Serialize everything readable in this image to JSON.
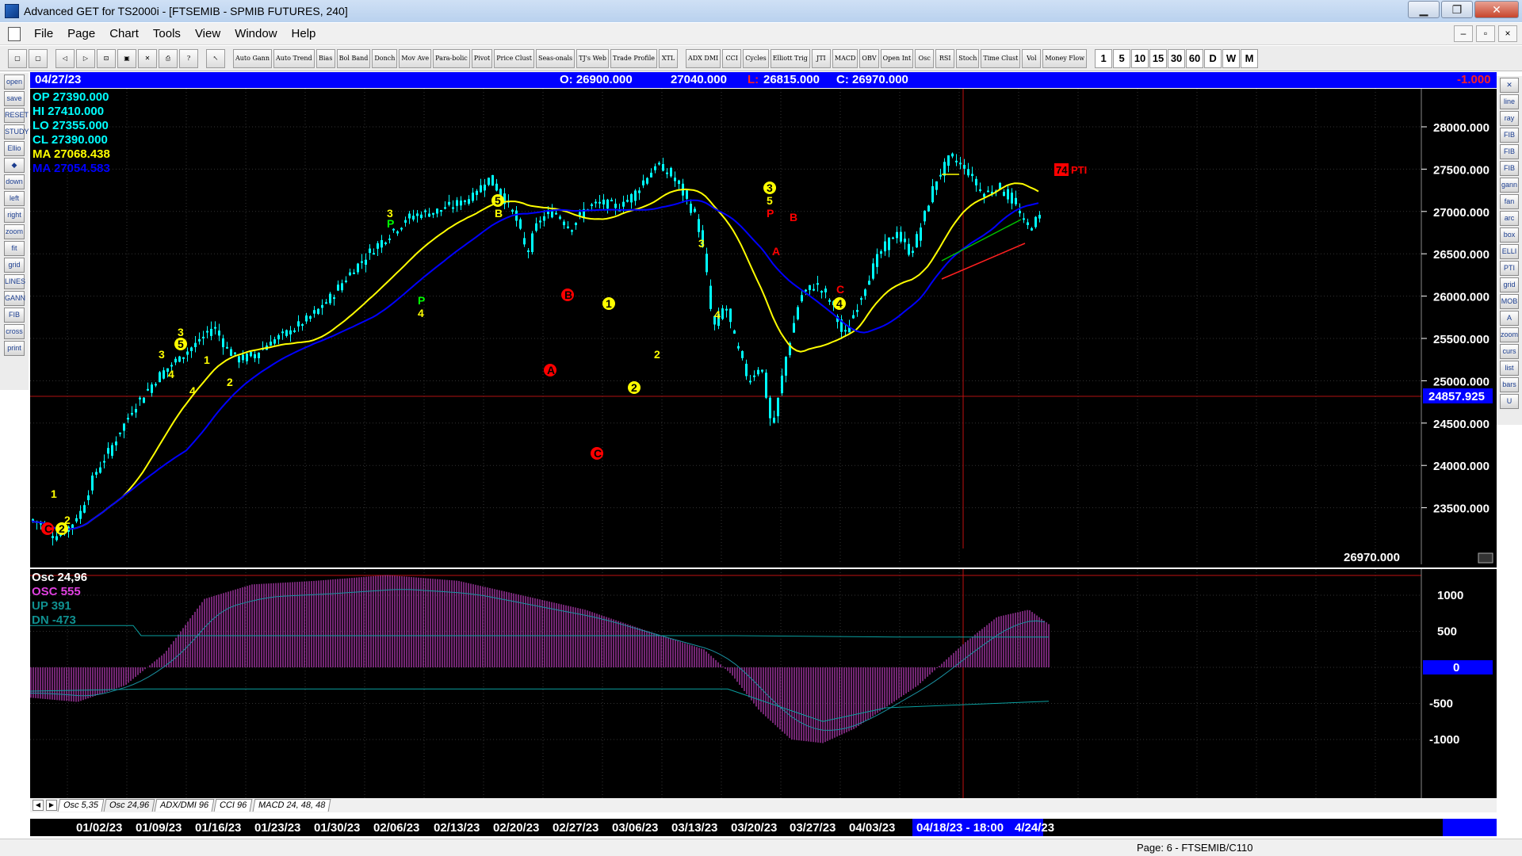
{
  "window": {
    "title": "Advanced GET for TS2000i - [FTSEMIB - SPMIB FUTURES, 240]",
    "minimize": "▁",
    "maximize": "❐",
    "close": "✕"
  },
  "menu": [
    "File",
    "Page",
    "Chart",
    "Tools",
    "View",
    "Window",
    "Help"
  ],
  "mdi": [
    "–",
    "▫",
    "×"
  ],
  "toolbar": {
    "icons": [
      "¹⁹",
      "99"
    ],
    "studies": [
      "Auto Gann",
      "Auto Trend",
      "Bias",
      "Bol Band",
      "Donch",
      "Mov Ave",
      "Para-bolic",
      "Pivot",
      "Price Clust",
      "Seas-onals",
      "TJ's Web",
      "Trade Profile",
      "XTL",
      "ADX DMI",
      "CCI",
      "Cycles",
      "Elliott Trig",
      "JTI",
      "MACD",
      "OBV",
      "Open Int",
      "Osc",
      "RSI",
      "Stoch",
      "Time Clust",
      "Vol",
      "Money Flow"
    ],
    "periods": [
      "1",
      "5",
      "10",
      "15",
      "30",
      "60",
      "D",
      "W",
      "M"
    ]
  },
  "left_tools": [
    "open",
    "save",
    "RESET",
    "STUDY",
    "Elliott",
    "up",
    "down",
    "left",
    "right",
    "zoom",
    "fit",
    "grid",
    "LINES",
    "GANN",
    "FIB",
    "cross",
    "print"
  ],
  "right_tools": [
    "✕",
    "line",
    "ray",
    "FIB RET",
    "FIB EXT",
    "FIB TIME",
    "gann",
    "fan",
    "arc",
    "box",
    "ELLIPS",
    "PTI",
    "grid",
    "MOB",
    "A",
    "zoom",
    "cursor",
    "list",
    "bars",
    "U"
  ],
  "infobar": {
    "date": "04/27/23",
    "open": "O: 26900.000",
    "high": "27040.000",
    "low_label": "L:",
    "low": "26815.000",
    "close": "C: 26970.000",
    "change": "-1.000"
  },
  "price_legend": {
    "op": "OP  27390.000",
    "hi": "HI   27410.000",
    "lo": "LO  27355.000",
    "cl": "CL  27390.000",
    "ma1": "MA  27068.438",
    "ma2": "MA  27054.583"
  },
  "price_axis": {
    "ticks": [
      "28000.000",
      "27500.000",
      "27000.000",
      "26500.000",
      "26000.000",
      "25500.000",
      "25000.000",
      "24500.000",
      "24000.000",
      "23500.000"
    ],
    "cursor_value": "24857.925",
    "last_value": "26970.000",
    "pti": "74",
    "pti_label": "PTI"
  },
  "osc_legend": {
    "name": "Osc 24,96",
    "osc": "OSC 555",
    "up": "UP   391",
    "dn": "DN   -473"
  },
  "osc_axis": {
    "ticks": [
      "1000",
      "500",
      "0",
      "-500",
      "-1000"
    ]
  },
  "tabs": [
    "Osc 5,35",
    "Osc 24,96",
    "ADX/DMI 96",
    "CCI 96",
    "MACD 24, 48, 48"
  ],
  "dates": [
    "01/02/23",
    "01/09/23",
    "01/16/23",
    "01/23/23",
    "01/30/23",
    "02/06/23",
    "02/13/23",
    "02/20/23",
    "02/27/23",
    "03/06/23",
    "03/13/23",
    "03/20/23",
    "03/27/23",
    "04/03/23",
    "04/18/23 - 18:00",
    "4/24/23"
  ],
  "status": "Page: 6 - FTSEMIB/C110",
  "colors": {
    "candle": "#00ffff",
    "ma_fast": "#ffff00",
    "ma_slow": "#0000ff",
    "osc": "#c040c0",
    "wave": "#ffff00",
    "abc": "#ff0000",
    "p_label": "#00ff00"
  },
  "wave_labels": [
    {
      "t": "C",
      "c": "red"
    },
    {
      "t": "2",
      "c": "yellow"
    },
    {
      "t": "1",
      "c": "yellow"
    },
    {
      "t": "2",
      "c": "yellow"
    },
    {
      "t": "3",
      "c": "yellow"
    },
    {
      "t": "4",
      "c": "yellow"
    },
    {
      "t": "5",
      "c": "yellow"
    },
    {
      "t": "3",
      "c": "yellow"
    },
    {
      "t": "1",
      "c": "yellow"
    },
    {
      "t": "2",
      "c": "yellow"
    },
    {
      "t": "4",
      "c": "yellow"
    },
    {
      "t": "3",
      "c": "yellow"
    },
    {
      "t": "P",
      "c": "green"
    },
    {
      "t": "P",
      "c": "green"
    },
    {
      "t": "4",
      "c": "yellow"
    },
    {
      "t": "5",
      "c": "yellow"
    },
    {
      "t": "B",
      "c": "yellow"
    },
    {
      "t": "A",
      "c": "red"
    },
    {
      "t": "B",
      "c": "red"
    },
    {
      "t": "C",
      "c": "red"
    },
    {
      "t": "1",
      "c": "yellow"
    },
    {
      "t": "2",
      "c": "yellow"
    },
    {
      "t": "2",
      "c": "yellow"
    },
    {
      "t": "3",
      "c": "yellow"
    },
    {
      "t": "4",
      "c": "yellow"
    },
    {
      "t": "3",
      "c": "yellow"
    },
    {
      "t": "5",
      "c": "yellow"
    },
    {
      "t": "P",
      "c": "red"
    },
    {
      "t": "A",
      "c": "red"
    },
    {
      "t": "B",
      "c": "red"
    },
    {
      "t": "C",
      "c": "red"
    },
    {
      "t": "4",
      "c": "yellow"
    }
  ]
}
